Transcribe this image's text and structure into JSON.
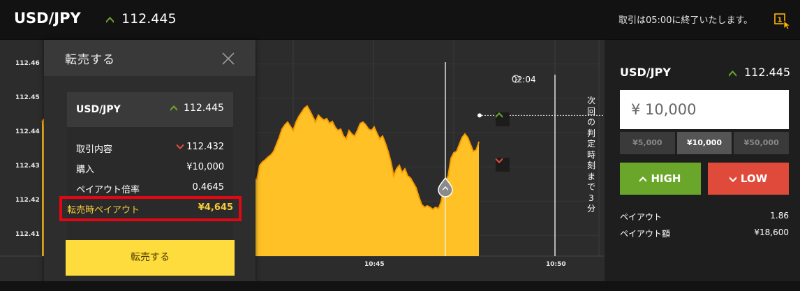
{
  "header": {
    "symbol": "USD/JPY",
    "price": "112.445",
    "notice": "取引は05:00に終了いたします。"
  },
  "chart": {
    "y_ticks": [
      "112.46",
      "112.45",
      "112.44",
      "112.43",
      "112.42",
      "112.41"
    ],
    "x_ticks": [
      "10:45",
      "10:50"
    ],
    "timer": "02:04",
    "vertical_text": [
      "次",
      "回",
      "の",
      "判",
      "定",
      "時",
      "刻",
      "ま",
      "で",
      "3",
      "分"
    ]
  },
  "chart_data": {
    "type": "area",
    "x_ticks": [
      "10:45",
      "10:50"
    ],
    "y_ticks": [
      "112.46",
      "112.45",
      "112.44",
      "112.43",
      "112.42",
      "112.41"
    ],
    "ylim": [
      112.405,
      112.465
    ],
    "current_price": 112.445,
    "grid": true
  },
  "modal": {
    "title": "転売する",
    "card": {
      "symbol": "USD/JPY",
      "price": "112.445",
      "rows": [
        {
          "label": "取引内容",
          "value": "112.432"
        },
        {
          "label": "購入",
          "value": "¥10,000"
        },
        {
          "label": "ペイアウト倍率",
          "value": "0.4645"
        }
      ],
      "payout_label": "転売時ペイアウト",
      "payout_value": "¥4,645"
    },
    "button_label": "転売する"
  },
  "right_panel": {
    "symbol": "USD/JPY",
    "price": "112.445",
    "amount_value": "¥ 10,000",
    "presets": [
      "¥5,000",
      "¥10,000",
      "¥50,000"
    ],
    "high_label": "HIGH",
    "low_label": "LOW",
    "payout_label": "ペイアウト",
    "payout_value": "1.86",
    "payout_amount_label": "ペイアウト額",
    "payout_amount_value": "¥18,600"
  },
  "colors": {
    "up": "#6aa62a",
    "down": "#e04a3a",
    "chart_fill": "#ffc125",
    "highlight": "#e30613",
    "resell_button": "#ffdc3e"
  }
}
